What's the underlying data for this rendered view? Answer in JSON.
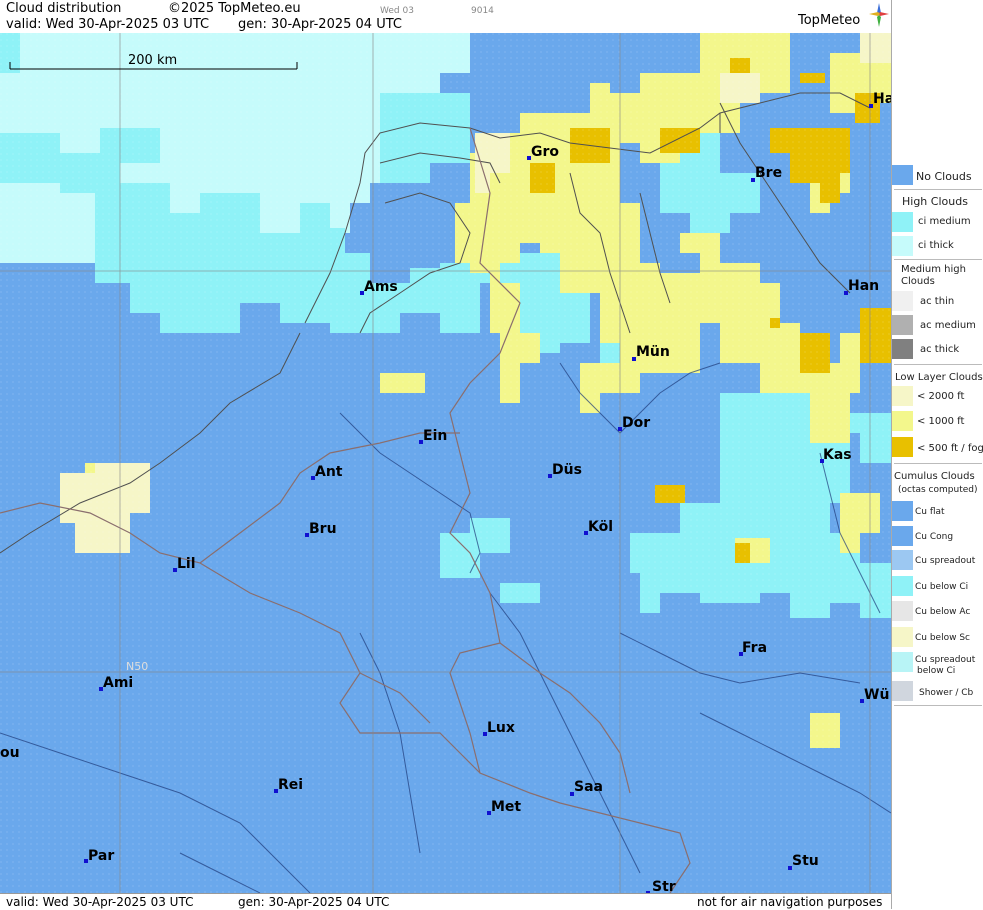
{
  "header": {
    "title": "Cloud distribution",
    "copyright": "©2025 TopMeteo.eu",
    "valid_line": "valid:  Wed  30-Apr-2025  03 UTC",
    "gen_line": "gen: 30-Apr-2025 04 UTC",
    "mini_label_1": "Wed 03",
    "mini_label_2": "9014",
    "logo": "TopMeteo"
  },
  "map": {
    "scale_label": "200 km",
    "lat_label": "N50",
    "cities": [
      "Gro",
      "Ha",
      "Bre",
      "Ams",
      "Han",
      "Mün",
      "Dor",
      "Ein",
      "Ant",
      "Düs",
      "Kas",
      "Bru",
      "Köl",
      "Lil",
      "Fra",
      "Ami",
      "Wü",
      "Lux",
      "ou",
      "Rei",
      "Saa",
      "Met",
      "Par",
      "Stu",
      "Str"
    ]
  },
  "footer": {
    "valid_line": "valid:  Wed  30-Apr-2025  03 UTC",
    "gen_line": "gen: 30-Apr-2025 04 UTC",
    "note": "not for air navigation purposes"
  },
  "legend": {
    "no_clouds": "No Clouds",
    "high_clouds": "High Clouds",
    "ci_medium": "ci medium",
    "ci_thick": "ci thick",
    "medium_high_1": "Medium high",
    "medium_high_2": "Clouds",
    "ac_thin": "ac thin",
    "ac_medium": "ac medium",
    "ac_thick": "ac thick",
    "low_layer": "Low Layer Clouds",
    "lt2000": "< 2000 ft",
    "lt1000": "< 1000 ft",
    "lt500": "< 500 ft / fog",
    "cumulus_1": "Cumulus Clouds",
    "cumulus_2": "(octas computed)",
    "cu_flat": "Cu flat",
    "cu_cong": "Cu Cong",
    "cu_spreadout": "Cu spreadout",
    "cu_below_ci": "Cu below Ci",
    "cu_below_ac": "Cu below Ac",
    "cu_below_sc": "Cu below Sc",
    "cu_spread_below_ci_1": "Cu spreadout",
    "cu_spread_below_ci_2": "below Ci",
    "shower": "Shower / Cb"
  },
  "colors": {
    "no_clouds": "#6aa8ec",
    "ci_medium": "#8ff2f7",
    "ci_thick": "#c6fbfb",
    "low_2000": "#f3f78c",
    "low_1000": "#f6f6c8",
    "low_500": "#e8c000",
    "border": "#8a6e6e",
    "coast": "#505050"
  }
}
